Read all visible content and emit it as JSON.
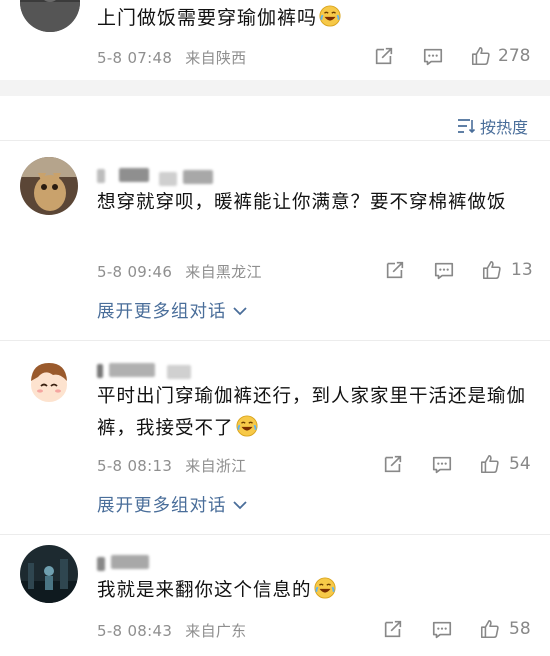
{
  "post": {
    "text": "上门做饭需要穿瑜伽裤吗",
    "emoji": "laughing-tears-emoji",
    "date": "5-8 07:48",
    "location": "来自陕西",
    "likes": "278"
  },
  "sort": {
    "label": "按热度",
    "icon": "sort-icon"
  },
  "comments": [
    {
      "text": "想穿就穿呗，暖裤能让你满意？要不穿棉裤做饭",
      "date": "5-8 09:46",
      "location": "来自黑龙江",
      "likes": "13",
      "expand": "展开更多组对话"
    },
    {
      "text": "平时出门穿瑜伽裤还行，到人家家里干活还是瑜伽裤，我接受不了",
      "date": "5-8 08:13",
      "location": "来自浙江",
      "likes": "54",
      "expand": "展开更多组对话"
    },
    {
      "text": "我就是来翻你这个信息的",
      "date": "5-8 08:43",
      "location": "来自广东",
      "likes": "58"
    }
  ],
  "colors": {
    "link": "#4a6e9a",
    "meta": "#8f8f8f",
    "band": "#f3f3f3"
  }
}
